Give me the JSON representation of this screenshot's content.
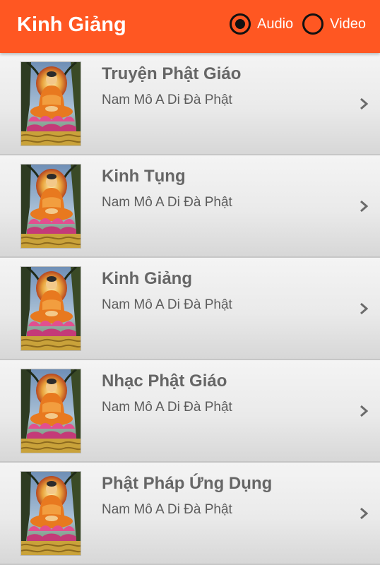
{
  "app": {
    "title": "Kinh Giảng",
    "accent_color": "#ff5722"
  },
  "mode": {
    "selected": "Audio",
    "options": [
      {
        "label": "Audio",
        "checked": true
      },
      {
        "label": "Video",
        "checked": false
      }
    ]
  },
  "list": {
    "items": [
      {
        "title": "Truyện Phật Giáo",
        "subtitle": "Nam Mô A Di Đà Phật",
        "image": "buddha-image",
        "icon": "chevron-right-icon"
      },
      {
        "title": "Kinh Tụng",
        "subtitle": "Nam Mô A Di Đà Phật",
        "image": "buddha-image",
        "icon": "chevron-right-icon"
      },
      {
        "title": "Kinh Giảng",
        "subtitle": "Nam Mô A Di Đà Phật",
        "image": "buddha-image",
        "icon": "chevron-right-icon"
      },
      {
        "title": "Nhạc Phật Giáo",
        "subtitle": "Nam Mô A Di Đà Phật",
        "image": "buddha-image",
        "icon": "chevron-right-icon"
      },
      {
        "title": "Phật Pháp Ứng Dụng",
        "subtitle": "Nam Mô A Di Đà Phật",
        "image": "buddha-image",
        "icon": "chevron-right-icon"
      }
    ]
  }
}
